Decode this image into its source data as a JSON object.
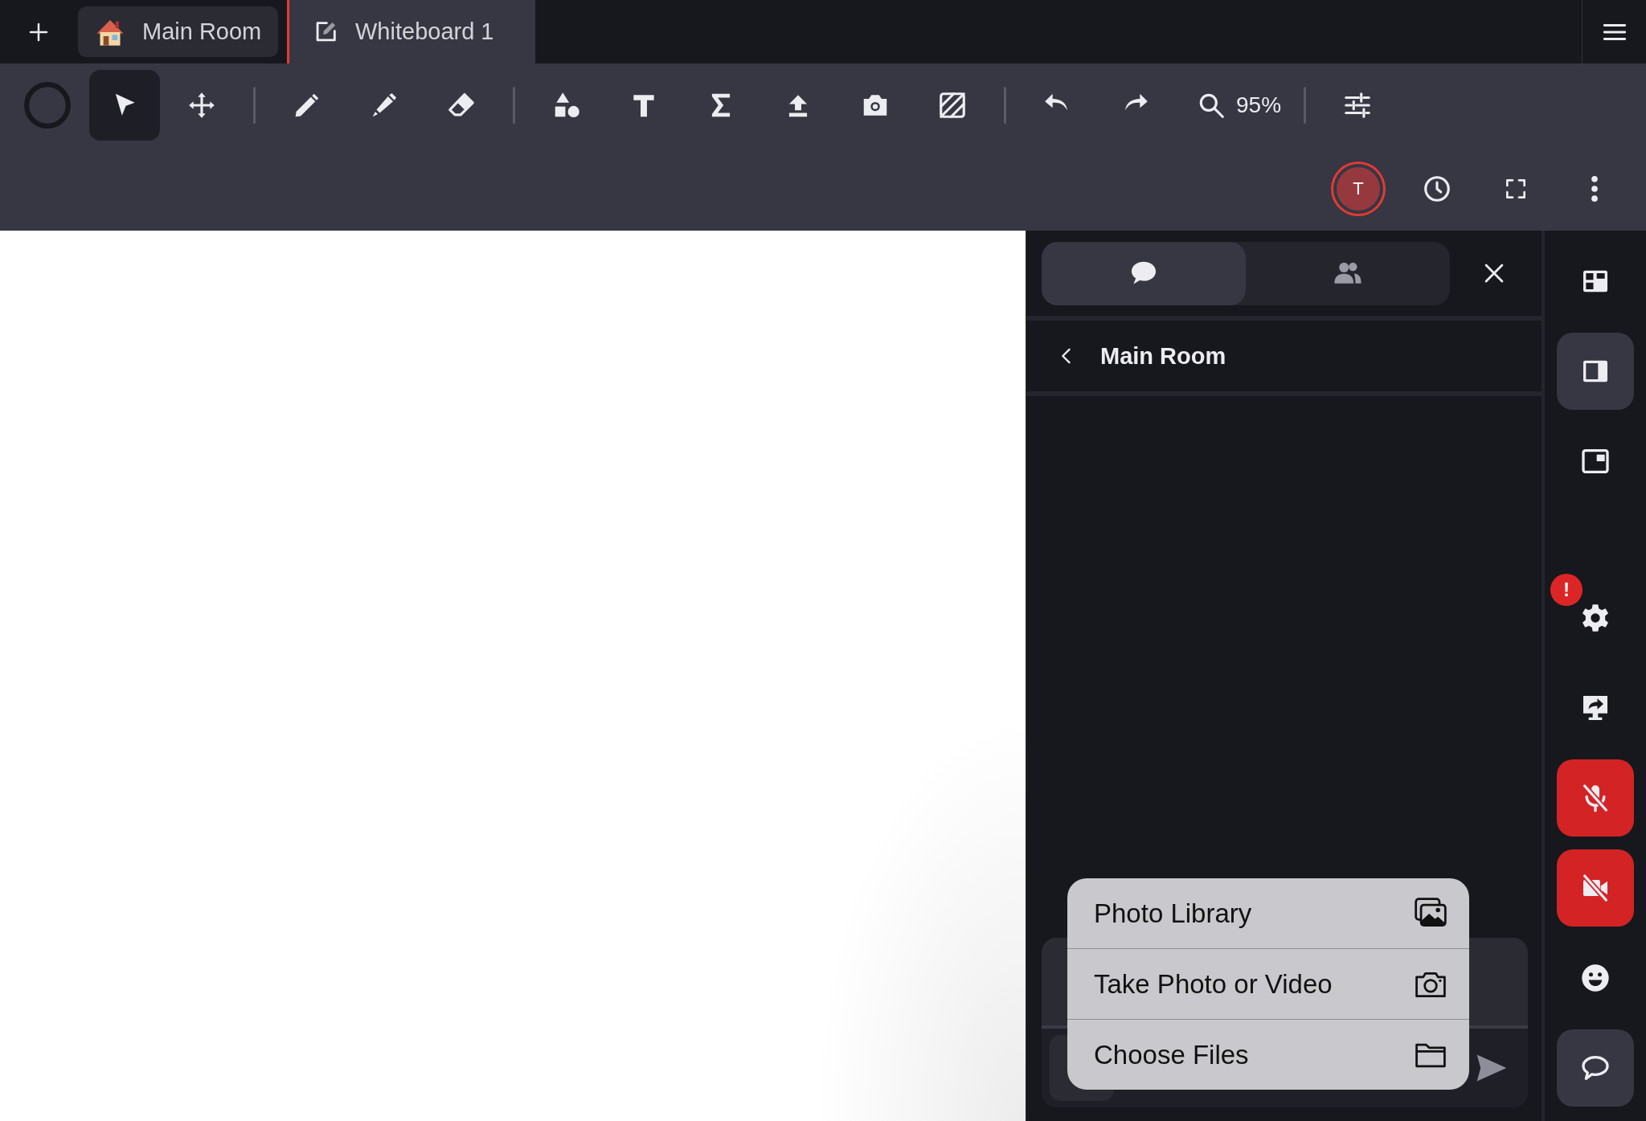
{
  "tabs": [
    {
      "kind": "room",
      "label": "Main Room",
      "selected": false
    },
    {
      "kind": "board",
      "label": "Whiteboard 1",
      "selected": true
    }
  ],
  "toolbar": {
    "tools": [
      {
        "kind": "color",
        "selected": false
      },
      {
        "kind": "select",
        "selected": true
      },
      {
        "kind": "pan",
        "selected": false
      },
      {
        "kind": "sep"
      },
      {
        "kind": "pen",
        "selected": false
      },
      {
        "kind": "highlighter",
        "selected": false
      },
      {
        "kind": "eraser",
        "selected": false
      },
      {
        "kind": "sep"
      },
      {
        "kind": "shapes",
        "selected": false
      },
      {
        "kind": "text",
        "selected": false
      },
      {
        "kind": "math",
        "selected": false
      },
      {
        "kind": "upload",
        "selected": false
      },
      {
        "kind": "camera",
        "selected": false
      },
      {
        "kind": "pattern",
        "selected": false
      },
      {
        "kind": "sep"
      },
      {
        "kind": "undo",
        "selected": false
      },
      {
        "kind": "redo",
        "selected": false
      },
      {
        "kind": "zoom",
        "label": "95%"
      },
      {
        "kind": "sep"
      },
      {
        "kind": "settings",
        "selected": false
      }
    ],
    "avatar": {
      "initial": "T"
    }
  },
  "panel": {
    "tabs": [
      {
        "kind": "chat",
        "selected": true
      },
      {
        "kind": "people",
        "selected": false
      }
    ],
    "header": {
      "title": "Main Room"
    },
    "attach_menu": [
      {
        "kind": "library",
        "label": "Photo Library"
      },
      {
        "kind": "camera",
        "label": "Take Photo or Video"
      },
      {
        "kind": "files",
        "label": "Choose Files"
      }
    ]
  },
  "rail": [
    {
      "kind": "grid",
      "selected": false
    },
    {
      "kind": "sidebar",
      "selected": true
    },
    {
      "kind": "pip",
      "selected": false
    },
    {
      "kind": "settings",
      "selected": false,
      "badge": "!"
    },
    {
      "kind": "share",
      "selected": false
    },
    {
      "kind": "mic",
      "muted": true
    },
    {
      "kind": "video",
      "muted": true
    },
    {
      "kind": "emoji",
      "selected": false
    },
    {
      "kind": "chat",
      "selected": true
    }
  ]
}
